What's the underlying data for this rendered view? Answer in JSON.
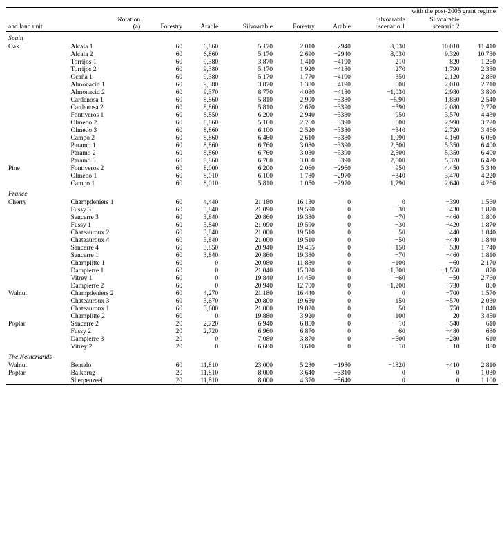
{
  "table": {
    "col_headers_row1": [
      "",
      "",
      "",
      "Rotation",
      "Forestry",
      "Arable",
      "Silvoarable",
      "Forestry",
      "Arable",
      "Silvoarable scenario 1",
      "Silvoarable scenario 2"
    ],
    "col_headers_row2_left": "and land unit",
    "col_headers_row2_right": "with the post-2005 grant regime",
    "col_headers_rotation": "Rotation (a)",
    "sections": [
      {
        "country": "Spain",
        "subsections": [
          {
            "species": "Oak",
            "rows": [
              [
                "Alcala 1",
                "60",
                "6,860",
                "5,170",
                "2,010",
                "−2940",
                "8,030",
                "10,010",
                "11,410"
              ],
              [
                "Alcala 2",
                "60",
                "6,860",
                "5,170",
                "2,690",
                "−2940",
                "8,030",
                "9,320",
                "10,730"
              ],
              [
                "Torrijos 1",
                "60",
                "9,380",
                "3,870",
                "1,410",
                "−4190",
                "210",
                "820",
                "1,260"
              ],
              [
                "Torrijos 2",
                "60",
                "9,380",
                "5,170",
                "1,920",
                "−4180",
                "270",
                "1,790",
                "2,380"
              ],
              [
                "Ocaña 1",
                "60",
                "9,380",
                "5,170",
                "1,770",
                "−4190",
                "350",
                "2,120",
                "2,860"
              ],
              [
                "Almonacid 1",
                "60",
                "9,380",
                "3,870",
                "1,380",
                "−4190",
                "600",
                "2,010",
                "2,710"
              ],
              [
                "Almonacid 2",
                "60",
                "9,370",
                "8,770",
                "4,080",
                "−4180",
                "−1,030",
                "2,980",
                "3,890"
              ],
              [
                "Cardenosa 1",
                "60",
                "8,860",
                "5,810",
                "2,900",
                "−3380",
                "−5,90",
                "1,850",
                "2,540"
              ],
              [
                "Cardenosa 2",
                "60",
                "8,860",
                "5,810",
                "2,670",
                "−3390",
                "−590",
                "2,080",
                "2,770"
              ],
              [
                "Fontiveros 1",
                "60",
                "8,850",
                "6,200",
                "2,940",
                "−3380",
                "950",
                "3,570",
                "4,430"
              ],
              [
                "Olmedo 2",
                "60",
                "8,860",
                "5,160",
                "2,260",
                "−3390",
                "600",
                "2,990",
                "3,720"
              ],
              [
                "Olmedo 3",
                "60",
                "8,860",
                "6,100",
                "2,520",
                "−3380",
                "−340",
                "2,720",
                "3,460"
              ],
              [
                "Campo 2",
                "60",
                "8,860",
                "6,460",
                "2,610",
                "−3380",
                "1,990",
                "4,160",
                "6,060"
              ],
              [
                "Paramo 1",
                "60",
                "8,860",
                "6,760",
                "3,080",
                "−3390",
                "2,500",
                "5,350",
                "6,400"
              ],
              [
                "Paramo 2",
                "60",
                "8,860",
                "6,760",
                "3,080",
                "−3390",
                "2,500",
                "5,350",
                "6,400"
              ],
              [
                "Paramo 3",
                "60",
                "8,860",
                "6,760",
                "3,060",
                "−3390",
                "2,500",
                "5,370",
                "6,420"
              ]
            ]
          },
          {
            "species": "Pine",
            "rows": [
              [
                "Fontiveros 2",
                "60",
                "8,000",
                "6,200",
                "2,060",
                "−2960",
                "950",
                "4,450",
                "5,340"
              ],
              [
                "Olmedo 1",
                "60",
                "8,010",
                "6,100",
                "1,780",
                "−2970",
                "−340",
                "3,470",
                "4,220"
              ],
              [
                "Campo 1",
                "60",
                "8,010",
                "5,810",
                "1,050",
                "−2970",
                "1,790",
                "2,640",
                "4,260"
              ]
            ]
          }
        ]
      },
      {
        "country": "France",
        "subsections": [
          {
            "species": "Cherry",
            "rows": [
              [
                "Champdeniers 1",
                "60",
                "4,440",
                "21,180",
                "16,130",
                "0",
                "0",
                "−390",
                "1,560"
              ],
              [
                "Fussy 3",
                "60",
                "3,840",
                "21,090",
                "19,590",
                "0",
                "−30",
                "−430",
                "1,870"
              ],
              [
                "Sancerre 3",
                "60",
                "3,840",
                "20,860",
                "19,380",
                "0",
                "−70",
                "−460",
                "1,800"
              ],
              [
                "Fussy 1",
                "60",
                "3,840",
                "21,090",
                "19,590",
                "0",
                "−30",
                "−420",
                "1,870"
              ],
              [
                "Chateauroux 2",
                "60",
                "3,840",
                "21,000",
                "19,510",
                "0",
                "−50",
                "−440",
                "1,840"
              ],
              [
                "Chateauroux 4",
                "60",
                "3,840",
                "21,000",
                "19,510",
                "0",
                "−50",
                "−440",
                "1,840"
              ],
              [
                "Sancerre 4",
                "60",
                "3,850",
                "20,940",
                "19,455",
                "0",
                "−150",
                "−530",
                "1,740"
              ],
              [
                "Sancerre 1",
                "60",
                "3,840",
                "20,860",
                "19,380",
                "0",
                "−70",
                "−460",
                "1,810"
              ],
              [
                "Champlitte 1",
                "60",
                "0",
                "20,080",
                "11,880",
                "0",
                "−100",
                "−60",
                "2,170"
              ],
              [
                "Dampierre 1",
                "60",
                "0",
                "21,040",
                "15,320",
                "0",
                "−1,300",
                "−1,550",
                "870"
              ],
              [
                "Vitrey 1",
                "60",
                "0",
                "19,840",
                "14,450",
                "0",
                "−60",
                "−50",
                "2,760"
              ],
              [
                "Dampierre 2",
                "60",
                "0",
                "20,940",
                "12,700",
                "0",
                "−1,200",
                "−730",
                "860"
              ]
            ]
          },
          {
            "species": "Walnut",
            "rows": [
              [
                "Champdeniers 2",
                "60",
                "4,270",
                "21,180",
                "16,440",
                "0",
                "0",
                "−700",
                "1,570"
              ],
              [
                "Chateauroux 3",
                "60",
                "3,670",
                "20,800",
                "19,630",
                "0",
                "150",
                "−570",
                "2,030"
              ],
              [
                "Chateauroux 1",
                "60",
                "3,680",
                "21,000",
                "19,820",
                "0",
                "−50",
                "−750",
                "1,840"
              ],
              [
                "Champlitte 2",
                "60",
                "0",
                "19,880",
                "3,920",
                "0",
                "100",
                "20",
                "3,450"
              ]
            ]
          },
          {
            "species": "Poplar",
            "rows": [
              [
                "Sancerre 2",
                "20",
                "2,720",
                "6,940",
                "6,850",
                "0",
                "−10",
                "−540",
                "610"
              ],
              [
                "Fussy 2",
                "20",
                "2,720",
                "6,960",
                "6,870",
                "0",
                "60",
                "−480",
                "680"
              ],
              [
                "Dampierre 3",
                "20",
                "0",
                "7,080",
                "3,870",
                "0",
                "−500",
                "−280",
                "610"
              ],
              [
                "Vitrey 2",
                "20",
                "0",
                "6,600",
                "3,610",
                "0",
                "−10",
                "−10",
                "880"
              ]
            ]
          }
        ]
      },
      {
        "country": "The Netherlands",
        "subsections": [
          {
            "species": "Walnut",
            "rows": [
              [
                "Bentelo",
                "60",
                "11,810",
                "23,000",
                "5,230",
                "−1980",
                "−1820",
                "−410",
                "2,810"
              ]
            ]
          },
          {
            "species": "Poplar",
            "rows": [
              [
                "Balkbrug",
                "20",
                "11,810",
                "8,000",
                "3,640",
                "−3310",
                "0",
                "0",
                "1,030"
              ],
              [
                "Sherpenzeel",
                "20",
                "11,810",
                "8,000",
                "4,370",
                "−3640",
                "0",
                "0",
                "1,100"
              ]
            ]
          }
        ]
      }
    ]
  }
}
